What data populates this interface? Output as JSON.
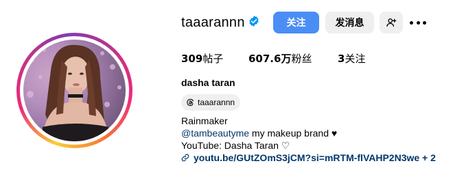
{
  "profile": {
    "username": "taaarannn",
    "verified_icon": "verified-badge-icon",
    "follow_label": "关注",
    "message_label": "发消息",
    "add_user_icon": "add-user-icon",
    "more_icon": "more-options-icon"
  },
  "stats": {
    "posts_value": "309",
    "posts_label": "帖子",
    "followers_value": "607.6万",
    "followers_label": "粉丝",
    "following_value": "3",
    "following_label": "关注"
  },
  "bio": {
    "full_name": "dasha taran",
    "threads_handle": "taaarannn",
    "threads_icon": "threads-icon",
    "line1": "Rainmaker",
    "mention": "@tambeautyme",
    "line2_rest": " my makeup brand ♥",
    "line3": "YouTube: Dasha Taran ♡",
    "link_icon": "link-icon",
    "link_text": "youtu.be/GUtZOmS3jCM?si=mRTM-flVAHP2N3we + 2"
  },
  "colors": {
    "follow_button": "#4a8ef5",
    "secondary_button": "#efefef",
    "link": "#00376b",
    "verified": "#0095f6"
  }
}
